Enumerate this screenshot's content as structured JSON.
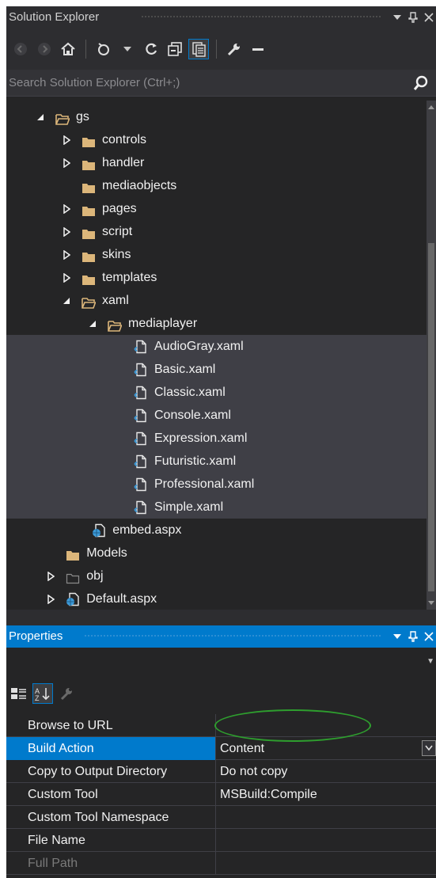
{
  "solution_explorer": {
    "title": "Solution Explorer",
    "search_placeholder": "Search Solution Explorer (Ctrl+;)",
    "toolbar": [
      "back-icon",
      "forward-icon",
      "home-icon",
      "pending-changes-icon",
      "refresh-icon",
      "collapse-all-icon",
      "show-all-files-icon",
      "properties-icon",
      "preview-icon"
    ],
    "tree": [
      {
        "label": "gs",
        "kind": "folder-open",
        "expander": "expanded",
        "depth": 0
      },
      {
        "label": "controls",
        "kind": "folder",
        "expander": "collapsed",
        "depth": 1
      },
      {
        "label": "handler",
        "kind": "folder",
        "expander": "collapsed",
        "depth": 1
      },
      {
        "label": "mediaobjects",
        "kind": "folder",
        "expander": "none",
        "depth": 1
      },
      {
        "label": "pages",
        "kind": "folder",
        "expander": "collapsed",
        "depth": 1
      },
      {
        "label": "script",
        "kind": "folder",
        "expander": "collapsed",
        "depth": 1
      },
      {
        "label": "skins",
        "kind": "folder",
        "expander": "collapsed",
        "depth": 1
      },
      {
        "label": "templates",
        "kind": "folder",
        "expander": "collapsed",
        "depth": 1
      },
      {
        "label": "xaml",
        "kind": "folder-open",
        "expander": "expanded",
        "depth": 1
      },
      {
        "label": "mediaplayer",
        "kind": "folder-open",
        "expander": "expanded",
        "depth": 2
      },
      {
        "label": "AudioGray.xaml",
        "kind": "xaml",
        "expander": "none",
        "depth": 3,
        "selected": true
      },
      {
        "label": "Basic.xaml",
        "kind": "xaml",
        "expander": "none",
        "depth": 3,
        "selected": true
      },
      {
        "label": "Classic.xaml",
        "kind": "xaml",
        "expander": "none",
        "depth": 3,
        "selected": true
      },
      {
        "label": "Console.xaml",
        "kind": "xaml",
        "expander": "none",
        "depth": 3,
        "selected": true
      },
      {
        "label": "Expression.xaml",
        "kind": "xaml",
        "expander": "none",
        "depth": 3,
        "selected": true
      },
      {
        "label": "Futuristic.xaml",
        "kind": "xaml",
        "expander": "none",
        "depth": 3,
        "selected": true
      },
      {
        "label": "Professional.xaml",
        "kind": "xaml",
        "expander": "none",
        "depth": 3,
        "selected": true
      },
      {
        "label": "Simple.xaml",
        "kind": "xaml",
        "expander": "none",
        "depth": 3,
        "selected": true
      },
      {
        "label": "embed.aspx",
        "kind": "aspx",
        "expander": "none",
        "depth": 1.4
      },
      {
        "label": "Models",
        "kind": "folder",
        "expander": "none",
        "depth": 0.4
      },
      {
        "label": "obj",
        "kind": "folder-outline",
        "expander": "collapsed",
        "depth": 0.4
      },
      {
        "label": "Default.aspx",
        "kind": "aspx",
        "expander": "collapsed",
        "depth": 0.4
      }
    ]
  },
  "properties": {
    "title": "Properties",
    "toolbar": [
      "categorized-icon",
      "alphabetical-icon",
      "property-pages-icon"
    ],
    "rows": [
      {
        "name": "Browse to URL",
        "value": ""
      },
      {
        "name": "Build Action",
        "value": "Content",
        "selected": true,
        "has_dropdown": true
      },
      {
        "name": "Copy to Output Directory",
        "value": "Do not copy"
      },
      {
        "name": "Custom Tool",
        "value": "MSBuild:Compile"
      },
      {
        "name": "Custom Tool Namespace",
        "value": ""
      },
      {
        "name": "File Name",
        "value": ""
      },
      {
        "name": "Full Path",
        "value": "",
        "dim": true
      }
    ]
  },
  "colors": {
    "background": "#252526",
    "selection": "#3f3f46",
    "accent": "#007acc",
    "folder": "#dcb67a",
    "annotation": "#2e9e2e"
  }
}
